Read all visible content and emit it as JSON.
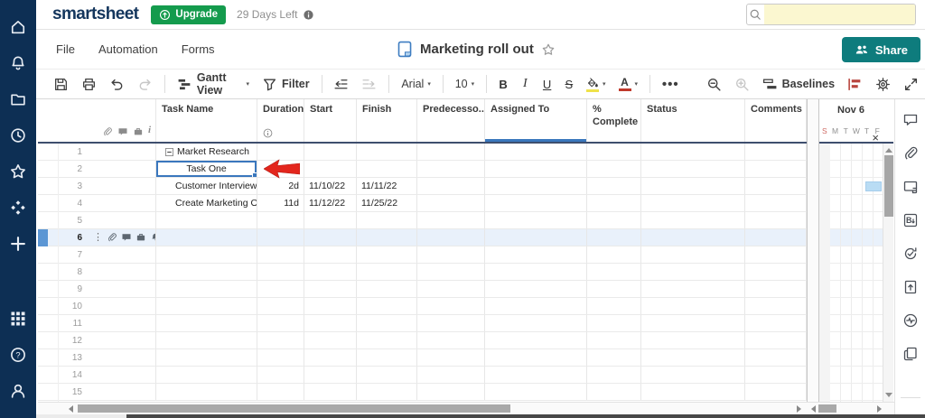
{
  "topbar": {
    "logo": "smartsheet",
    "upgrade": "Upgrade",
    "days_left": "29 Days Left"
  },
  "menu": {
    "items": [
      "File",
      "Automation",
      "Forms"
    ]
  },
  "sheet": {
    "title": "Marketing roll out"
  },
  "share": {
    "label": "Share"
  },
  "toolbar": {
    "gantt_view": "Gantt View",
    "filter": "Filter",
    "font": "Arial",
    "font_size": "10",
    "bold": "B",
    "italic": "I",
    "underline": "U",
    "strikethrough": "S",
    "text_color_letter": "A",
    "more": "•••",
    "baselines": "Baselines"
  },
  "grid": {
    "headers": [
      "Task Name",
      "Duration",
      "Start",
      "Finish",
      "Predecesso...",
      "Assigned To",
      "% Complete",
      "Status",
      "Comments"
    ],
    "header_icons": [
      "attachment",
      "comment",
      "proofs",
      "info-italic"
    ],
    "active_row_icons": [
      "attachment",
      "comment",
      "proofs",
      "reminder"
    ],
    "rows": [
      {
        "num": "1",
        "task": "Market Research",
        "parent": true
      },
      {
        "num": "2",
        "task": "Task One",
        "indent": true,
        "center": true,
        "selected": true
      },
      {
        "num": "3",
        "task": "Customer Interviews",
        "indent": true,
        "duration": "2d",
        "start": "11/10/22",
        "finish": "11/11/22"
      },
      {
        "num": "4",
        "task": "Create Marketing Ou",
        "indent": true,
        "duration": "11d",
        "start": "11/12/22",
        "finish": "11/25/22"
      },
      {
        "num": "5"
      },
      {
        "num": "6",
        "active": true
      },
      {
        "num": "7"
      },
      {
        "num": "8"
      },
      {
        "num": "9"
      },
      {
        "num": "10"
      },
      {
        "num": "11"
      },
      {
        "num": "12"
      },
      {
        "num": "13"
      },
      {
        "num": "14"
      },
      {
        "num": "15"
      }
    ]
  },
  "gantt": {
    "month": "Nov 6",
    "days": [
      "S",
      "M",
      "T",
      "W",
      "T",
      "F"
    ],
    "close": "×"
  },
  "left_rail": {
    "top": [
      "home",
      "notifications",
      "browse",
      "recents",
      "favorites",
      "solution-center",
      "create"
    ],
    "bottom": [
      "apps",
      "help",
      "account"
    ]
  },
  "right_rail": {
    "items": [
      "conversations",
      "attachments",
      "proofs-panel",
      "brandfolder",
      "update-requests",
      "publish",
      "activity-log",
      "summary"
    ]
  },
  "colors": {
    "sidebar_navy": "#0d2f54",
    "upgrade_green": "#149b4d",
    "share_teal": "#0e7c7d",
    "search_highlight_yellow": "#fbf7d0",
    "selection_blue": "#3a77bd",
    "active_row_blue": "#e9f1fb",
    "annotation_arrow_red": "#e3261d",
    "fill_color_swatch": "#efe24a",
    "text_color_swatch": "#c0392b",
    "gantt_bar_blue": "#b9dcf4",
    "weekend_red": "#cf6a64"
  }
}
